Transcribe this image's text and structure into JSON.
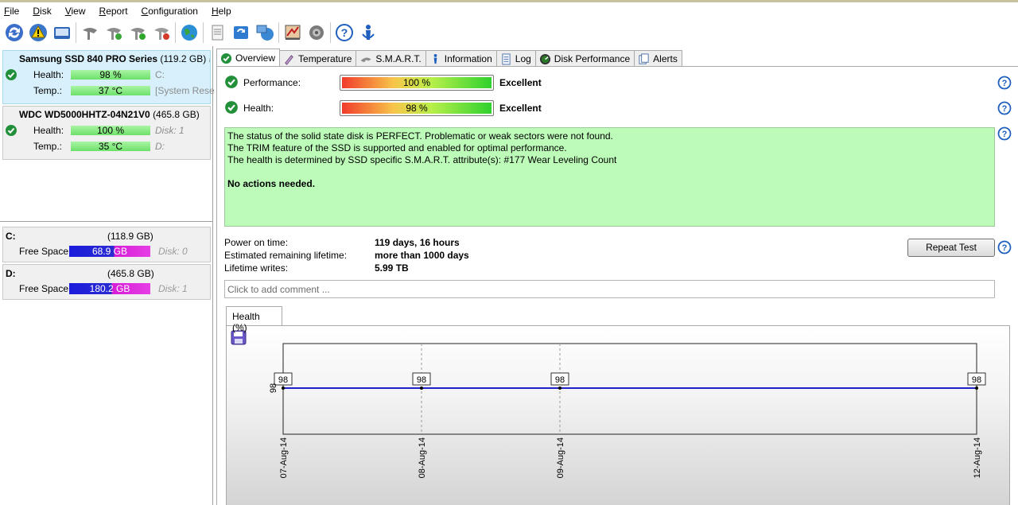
{
  "menu": [
    {
      "label": "File",
      "accel": "F",
      "rest": "ile"
    },
    {
      "label": "Disk",
      "accel": "D",
      "rest": "isk"
    },
    {
      "label": "View",
      "accel": "V",
      "rest": "iew"
    },
    {
      "label": "Report",
      "accel": "R",
      "rest": "eport"
    },
    {
      "label": "Configuration",
      "accel": "C",
      "rest": "onfiguration"
    },
    {
      "label": "Help",
      "accel": "H",
      "rest": "elp"
    }
  ],
  "disks": [
    {
      "name": "Samsung SSD 840 PRO Series",
      "size": "(119.2 GB)",
      "extra": "Di",
      "health_label": "Health:",
      "health": "98 %",
      "health_note": "C:",
      "temp_label": "Temp.:",
      "temp": "37 °C",
      "temp_note": "[System Rese"
    },
    {
      "name": "WDC WD5000HHTZ-04N21V0",
      "size": "(465.8 GB)",
      "health_label": "Health:",
      "health": "100 %",
      "health_note": "Disk: 1",
      "temp_label": "Temp.:",
      "temp": "35 °C",
      "temp_note": "D:"
    }
  ],
  "volumes": [
    {
      "letter": "C:",
      "size": "(118.9 GB)",
      "label": "Free Space",
      "free": "68.9 GB",
      "note": "Disk: 0"
    },
    {
      "letter": "D:",
      "size": "(465.8 GB)",
      "label": "Free Space",
      "free": "180.2 GB",
      "note": "Disk: 1"
    }
  ],
  "tabs": [
    {
      "label": "Overview",
      "icon": "check-icon"
    },
    {
      "label": "Temperature",
      "icon": "thermometer-icon"
    },
    {
      "label": "S.M.A.R.T.",
      "icon": "smart-icon"
    },
    {
      "label": "Information",
      "icon": "info-icon"
    },
    {
      "label": "Log",
      "icon": "log-icon"
    },
    {
      "label": "Disk Performance",
      "icon": "performance-icon"
    },
    {
      "label": "Alerts",
      "icon": "alerts-icon"
    }
  ],
  "overview": {
    "performance": {
      "label": "Performance:",
      "value": "100 %",
      "verdict": "Excellent"
    },
    "health": {
      "label": "Health:",
      "value": "98 %",
      "verdict": "Excellent"
    },
    "status_lines": [
      "The status of the solid state disk is PERFECT. Problematic or weak sectors were not found.",
      "The TRIM feature of the SSD is supported and enabled for optimal performance.",
      "The health is determined by SSD specific S.M.A.R.T. attribute(s):  #177 Wear Leveling Count"
    ],
    "status_action": "No actions needed.",
    "power_on_label": "Power on time:",
    "power_on": "119 days, 16 hours",
    "remaining_label": "Estimated remaining lifetime:",
    "remaining": "more than 1000 days",
    "writes_label": "Lifetime writes:",
    "writes": "5.99 TB",
    "repeat_button": "Repeat Test",
    "comment_placeholder": "Click to add comment ..."
  },
  "chart_tab": "Health (%)",
  "chart_data": {
    "type": "line",
    "title": "",
    "xlabel": "",
    "ylabel": "",
    "x": [
      "07-Aug-14",
      "08-Aug-14",
      "09-Aug-14",
      "12-Aug-14"
    ],
    "series": [
      {
        "values": [
          98,
          98,
          98,
          98
        ]
      }
    ],
    "ytick_labels": [
      "98"
    ],
    "grid": "vertical dashed",
    "colors": {
      "line": "#1f1fcc"
    }
  },
  "colors": {
    "accent_green": "#2fa83a",
    "status_bg": "#bdfbb9",
    "help_blue": "#1f5fbf"
  }
}
